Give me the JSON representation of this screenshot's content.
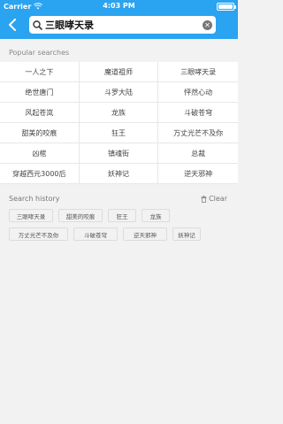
{
  "status_bar": {
    "carrier": "Carrier",
    "time": "4:03 PM"
  },
  "search": {
    "value": "三眼哮天录",
    "placeholder": ""
  },
  "popular": {
    "title": "Popular searches",
    "items": [
      "一人之下",
      "魔道祖师",
      "三眼哮天录",
      "绝世唐门",
      "斗罗大陆",
      "怦然心动",
      "风起苍岚",
      "龙族",
      "斗破苍穹",
      "甜美的咬痕",
      "狂王",
      "万丈光芒不及你",
      "凶棺",
      "镇魂街",
      "总裁",
      "穿越西元3000后",
      "妖神记",
      "逆天邪神"
    ]
  },
  "history": {
    "title": "Search history",
    "clear_label": "Clear",
    "items": [
      "三眼哮天录",
      "甜美的咬痕",
      "狂王",
      "龙族",
      "万丈光芒不及你",
      "斗破苍穹",
      "逆天邪神",
      "妖神记"
    ]
  },
  "colors": {
    "accent": "#2aa3f0"
  },
  "icons": {
    "back": "chevron-left-icon",
    "search": "search-icon",
    "clear": "clear-icon",
    "trash": "trash-icon",
    "wifi": "wifi-icon",
    "battery": "battery-icon"
  }
}
